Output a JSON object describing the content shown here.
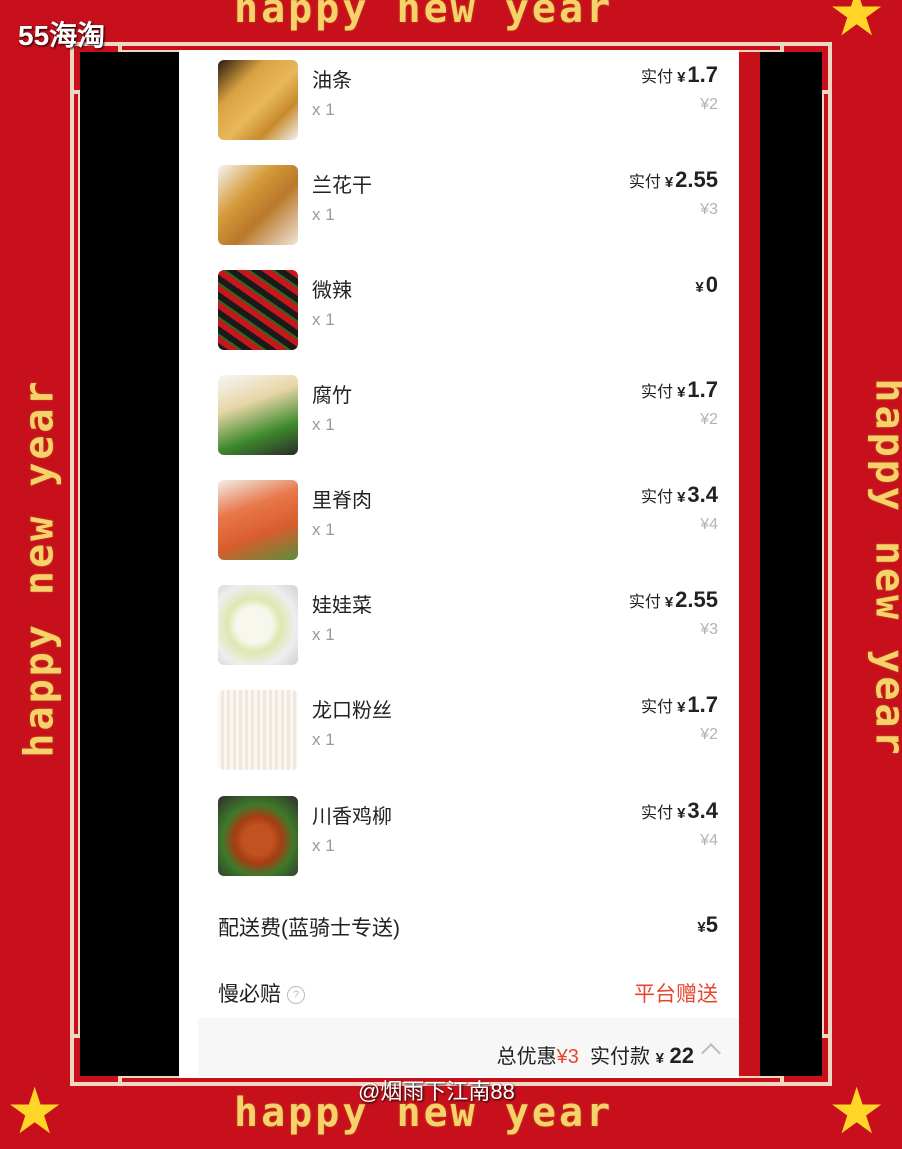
{
  "banner": {
    "text": "happy new year"
  },
  "logo": "55海淘",
  "watermark": "@烟雨下江南88",
  "items": [
    {
      "name": "油条",
      "qty": "x 1",
      "pay_label": "实付",
      "currency": "¥",
      "pay": "1.7",
      "orig": "¥2",
      "thumb": "youtiao-image"
    },
    {
      "name": "兰花干",
      "qty": "x 1",
      "pay_label": "实付",
      "currency": "¥",
      "pay": "2.55",
      "orig": "¥3",
      "thumb": "lanhuagan-image"
    },
    {
      "name": "微辣",
      "qty": "x 1",
      "pay_label": "",
      "currency": "¥",
      "pay": "0",
      "orig": "",
      "thumb": "chili-image"
    },
    {
      "name": "腐竹",
      "qty": "x 1",
      "pay_label": "实付",
      "currency": "¥",
      "pay": "1.7",
      "orig": "¥2",
      "thumb": "fuzhu-image"
    },
    {
      "name": "里脊肉",
      "qty": "x 1",
      "pay_label": "实付",
      "currency": "¥",
      "pay": "3.4",
      "orig": "¥4",
      "thumb": "liji-image"
    },
    {
      "name": "娃娃菜",
      "qty": "x 1",
      "pay_label": "实付",
      "currency": "¥",
      "pay": "2.55",
      "orig": "¥3",
      "thumb": "cabbage-image"
    },
    {
      "name": "龙口粉丝",
      "qty": "x 1",
      "pay_label": "实付",
      "currency": "¥",
      "pay": "1.7",
      "orig": "¥2",
      "thumb": "vermicelli-image"
    },
    {
      "name": "川香鸡柳",
      "qty": "x 1",
      "pay_label": "实付",
      "currency": "¥",
      "pay": "3.4",
      "orig": "¥4",
      "thumb": "chicken-image"
    }
  ],
  "delivery": {
    "label": "配送费(蓝骑士专送)",
    "currency": "¥",
    "value": "5"
  },
  "late_guarantee": {
    "label": "慢必赔",
    "value": "平台赠送"
  },
  "summary": {
    "discount_label": "总优惠",
    "discount": "¥3",
    "paid_label": "实付款",
    "currency": "¥",
    "paid": "22"
  },
  "colors": {
    "frame": "#c8101c",
    "accent": "#e8462e",
    "banner": "#f7d26b",
    "star": "#ffd628"
  }
}
